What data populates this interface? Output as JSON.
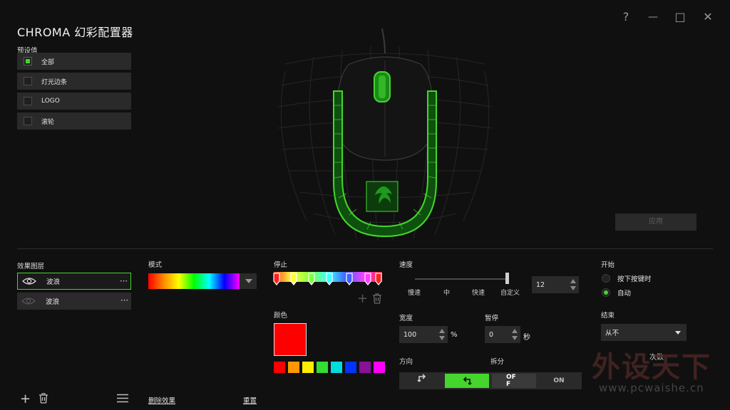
{
  "app": {
    "title": "CHROMA 幻彩配置器",
    "window_controls": [
      "?",
      "—",
      "□",
      "✕"
    ],
    "apply_label": "应用"
  },
  "presets": {
    "label": "预设值",
    "items": [
      {
        "label": "全部",
        "checked": true
      },
      {
        "label": "灯光边条",
        "checked": false
      },
      {
        "label": "LOGO",
        "checked": false
      },
      {
        "label": "滚轮",
        "checked": false
      }
    ]
  },
  "layers": {
    "label": "效果图层",
    "items": [
      {
        "label": "波浪",
        "more": "⋯"
      },
      {
        "label": "波浪",
        "more": "⋯"
      }
    ],
    "add": "+",
    "remove": "🗑",
    "menu": "☰"
  },
  "mode": {
    "label": "模式",
    "delete_effect": "删除效果",
    "reset": "重置"
  },
  "stops": {
    "label": "停止",
    "add": "+",
    "remove": "🗑",
    "colors": [
      "#ff2020",
      "#ffff40",
      "#80ff40",
      "#40ffff",
      "#4060ff",
      "#ff40ff",
      "#ff2020"
    ]
  },
  "color": {
    "label": "颜色",
    "current": "#ff0000",
    "swatches": [
      "#ff0000",
      "#ff9900",
      "#ffee00",
      "#33dd33",
      "#00dddd",
      "#0033ff",
      "#881199",
      "#ff00ff"
    ]
  },
  "speed": {
    "label": "速度",
    "ticks": [
      "慢速",
      "中",
      "快速",
      "自定义"
    ],
    "value": "12"
  },
  "width": {
    "label": "宽度",
    "value": "100",
    "unit": "%"
  },
  "pause": {
    "label": "暂停",
    "value": "0",
    "unit": "秒"
  },
  "direction": {
    "label": "方向",
    "arrows": [
      "⮍",
      "⮍"
    ]
  },
  "split": {
    "label": "拆分",
    "off": "OFF",
    "on": "ON"
  },
  "start": {
    "label": "开始",
    "options": [
      {
        "label": "按下按键时",
        "selected": false
      },
      {
        "label": "自动",
        "selected": true
      }
    ]
  },
  "end": {
    "label": "结束",
    "selected": "从不",
    "partial_text": "次数"
  },
  "watermark": {
    "text": "外设天下",
    "url": "www.pcwaishe.cn"
  }
}
